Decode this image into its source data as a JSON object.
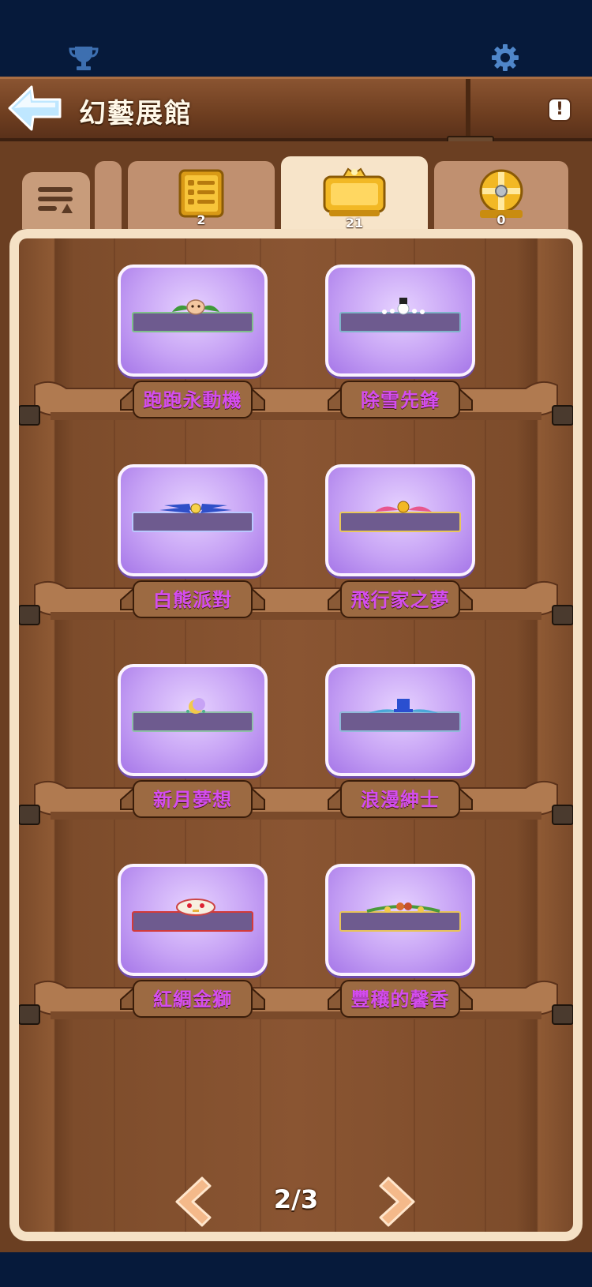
{
  "header": {
    "title": "幻藝展館",
    "info_symbol": "!"
  },
  "topbar": {
    "left_icon": "trophy-icon",
    "right_icon": "gear-icon"
  },
  "tabs": [
    {
      "id": "menu",
      "icon": "menu-sort-icon",
      "count": ""
    },
    {
      "id": "list",
      "icon": "gold-board-icon",
      "count": "2",
      "active": false
    },
    {
      "id": "frames",
      "icon": "gold-frame-icon",
      "count": "21",
      "active": true
    },
    {
      "id": "badge",
      "icon": "gold-badge-icon",
      "count": "0",
      "active": false
    }
  ],
  "items": [
    {
      "label": "跑跑永動機",
      "deco": "leaf-creature",
      "bar_border": "#7fbf8a"
    },
    {
      "label": "除雪先鋒",
      "deco": "snowman",
      "bar_border": "#7fb3c9"
    },
    {
      "label": "白熊派對",
      "deco": "blue-wings",
      "bar_border": "#b9c8ff"
    },
    {
      "label": "飛行家之夢",
      "deco": "pink-wings",
      "bar_border": "#e9c75a"
    },
    {
      "label": "新月夢想",
      "deco": "crescent",
      "bar_border": "#8fbfa8"
    },
    {
      "label": "浪漫紳士",
      "deco": "top-hat",
      "bar_border": "#8fb8d8"
    },
    {
      "label": "紅綢金獅",
      "deco": "lion-mask",
      "bar_border": "#d33a3a"
    },
    {
      "label": "豐穰的馨香",
      "deco": "fruit-garland",
      "bar_border": "#e7c35a"
    }
  ],
  "pager": {
    "current": 2,
    "total": 3,
    "text": "2/3"
  },
  "colors": {
    "label": "#d44df0",
    "card": "#c7a3f5",
    "wood": "#7d4c2b",
    "panel": "#f5e1c5"
  }
}
